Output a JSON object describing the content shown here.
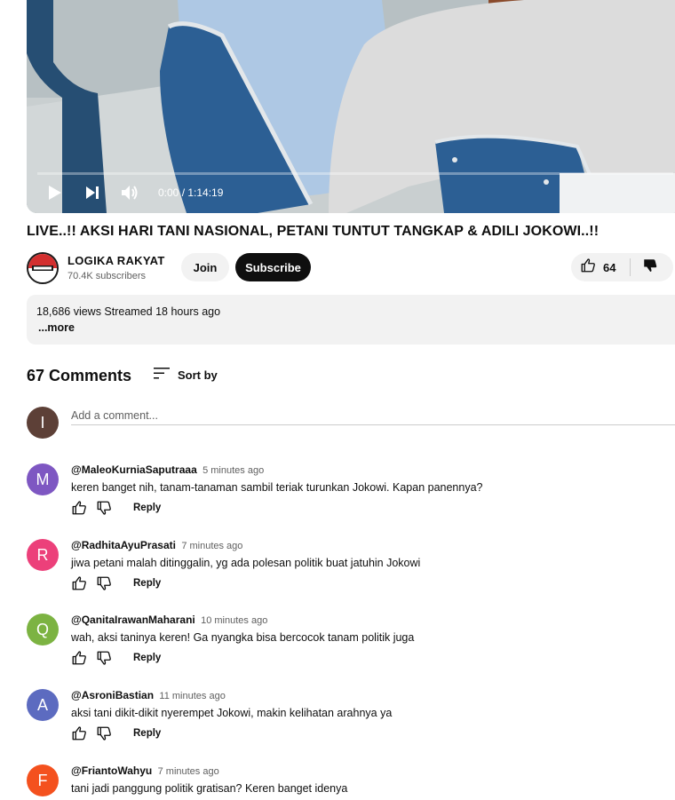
{
  "player": {
    "time": "0:00 / 1:14:19",
    "icons": [
      "play-icon",
      "next-icon",
      "volume-icon"
    ]
  },
  "video": {
    "title": "LIVE..!! AKSI HARI TANI NASIONAL, PETANI TUNTUT TANGKAP & ADILI JOKOWI..!!"
  },
  "channel": {
    "name": "LOGIKA RAKYAT",
    "subscribers": "70.4K subscribers",
    "join_label": "Join",
    "subscribe_label": "Subscribe",
    "likes": "64"
  },
  "description": {
    "meta": "18,686 views  Streamed 18 hours ago",
    "more_label": "...more"
  },
  "comments_section": {
    "count_label": "67 Comments",
    "sort_label": "Sort by",
    "add_placeholder": "Add a comment...",
    "my_initial": "I",
    "my_color": "#5d4037",
    "reply_label": "Reply",
    "items": [
      {
        "initial": "M",
        "color": "#7e57c2",
        "author": "@MaleoKurniaSaputraaa",
        "time": "5 minutes ago",
        "text": "keren banget nih, tanam-tanaman sambil teriak turunkan Jokowi. Kapan panennya?"
      },
      {
        "initial": "R",
        "color": "#ec407a",
        "author": "@RadhitaAyuPrasati",
        "time": "7 minutes ago",
        "text": "jiwa petani malah ditinggalin, yg ada polesan politik buat jatuhin Jokowi"
      },
      {
        "initial": "Q",
        "color": "#7cb342",
        "author": "@QanitaIrawanMaharani",
        "time": "10 minutes ago",
        "text": "wah, aksi taninya keren! Ga nyangka bisa bercocok tanam politik juga"
      },
      {
        "initial": "A",
        "color": "#5c6bc0",
        "author": "@AsroniBastian",
        "time": "11 minutes ago",
        "text": "aksi tani dikit-dikit nyerempet Jokowi, makin kelihatan arahnya ya"
      },
      {
        "initial": "F",
        "color": "#f4511e",
        "author": "@FriantoWahyu",
        "time": "7 minutes ago",
        "text": "tani jadi panggung politik gratisan? Keren banget idenya"
      }
    ]
  }
}
